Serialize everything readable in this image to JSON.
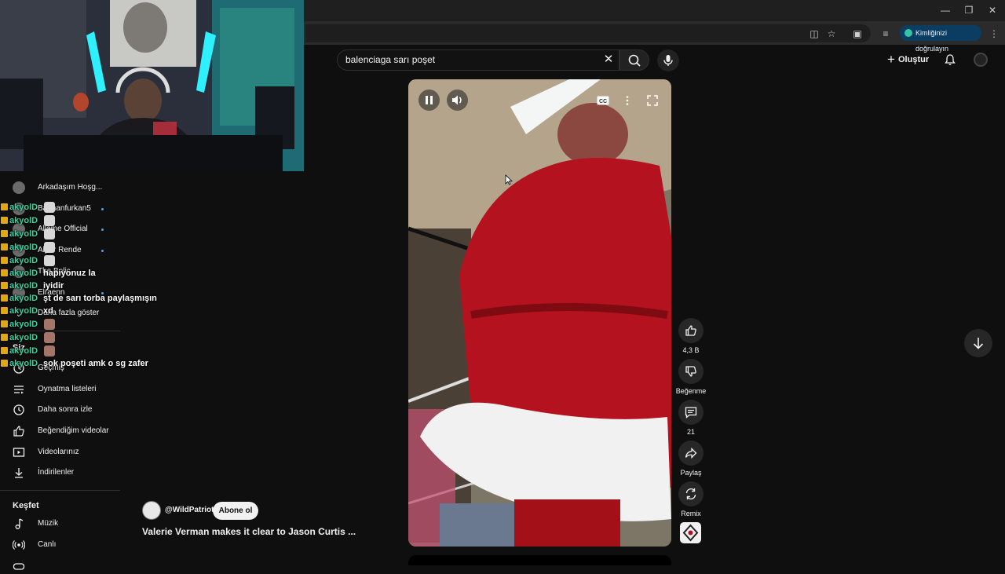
{
  "browser": {
    "verify_label": "Kimliğinizi doğrulayın",
    "window_buttons": [
      "minimize",
      "restore",
      "close"
    ]
  },
  "header": {
    "search_value": "balenciaga sarı poşet",
    "create_label": "Oluştur"
  },
  "sidebar": {
    "channels": [
      {
        "label": "Arkadaşım Hoşg..."
      },
      {
        "label": "Batmanfurkan5"
      },
      {
        "label": "Allame Official"
      },
      {
        "label": "Alper Rende"
      },
      {
        "label": "The Bolic"
      },
      {
        "label": "Elraenn"
      },
      {
        "label": "Daha fazla göster"
      }
    ],
    "you_heading": "Siz",
    "you_items": [
      {
        "label": "Geçmiş",
        "icon": "history-icon"
      },
      {
        "label": "Oynatma listeleri",
        "icon": "playlist-icon"
      },
      {
        "label": "Daha sonra izle",
        "icon": "clock-icon"
      },
      {
        "label": "Beğendiğim videolar",
        "icon": "thumb-up-icon"
      },
      {
        "label": "Videolarınız",
        "icon": "video-icon"
      },
      {
        "label": "İndirilenler",
        "icon": "download-icon"
      }
    ],
    "explore_heading": "Keşfet",
    "explore_items": [
      {
        "label": "Müzik",
        "icon": "music-icon"
      },
      {
        "label": "Canlı",
        "icon": "live-icon"
      }
    ]
  },
  "chat": {
    "username": "akyolD",
    "messages": [
      {
        "text": ""
      },
      {
        "text": ""
      },
      {
        "text": ""
      },
      {
        "text": ""
      },
      {
        "text": ""
      },
      {
        "text": "hapiyonuz la"
      },
      {
        "text": "iyidir"
      },
      {
        "text": "şt de sarı torba paylaşmışın"
      },
      {
        "text": "xd"
      },
      {
        "text": ""
      },
      {
        "text": ""
      },
      {
        "text": ""
      },
      {
        "text": "şok poşeti amk o sg zafer"
      }
    ]
  },
  "short": {
    "like_count": "4,3 B",
    "dislike_label": "Beğenme",
    "comment_count": "21",
    "share_label": "Paylaş",
    "remix_label": "Remix",
    "channel": "@WildPatriot",
    "subscribe_label": "Abone ol",
    "title": "Valerie Verman makes it clear to Jason Curtis ..."
  },
  "colors": {
    "background": "#0f0f0f",
    "chat_username": "#35d4a0",
    "chat_badge": "#e2a617",
    "verify_bg": "#0b3d63",
    "live_dot": "#3ea6ff"
  }
}
